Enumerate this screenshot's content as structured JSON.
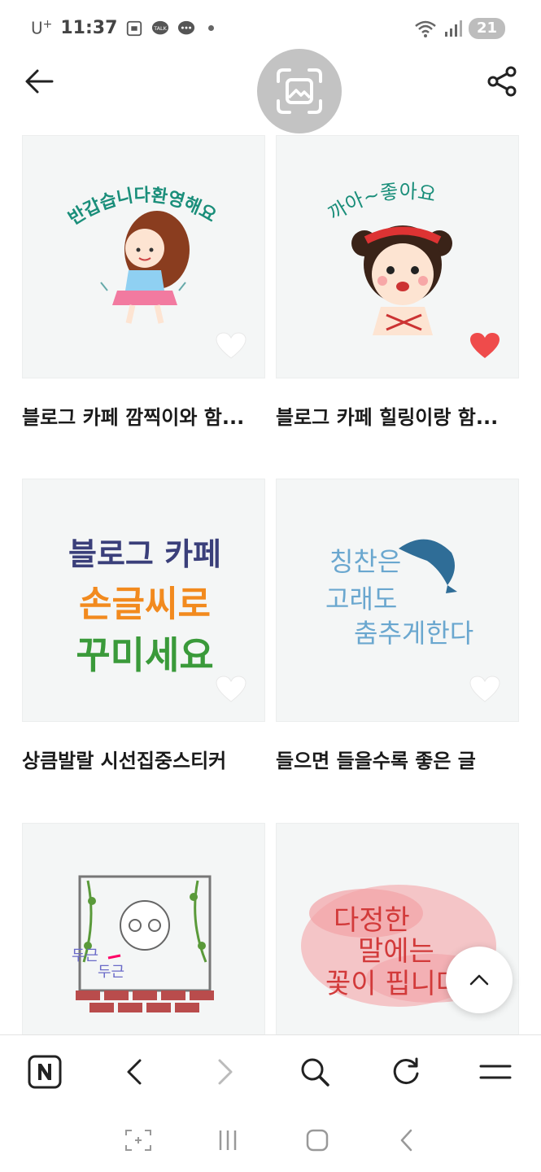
{
  "status_bar": {
    "carrier": "U",
    "carrier_sup": "+",
    "time": "11:37",
    "battery": "21"
  },
  "header": {
    "icons": [
      "back-arrow-icon",
      "image-search-icon",
      "share-icon"
    ]
  },
  "cards": [
    {
      "title": "블로그 카페 깜찍이와 함...",
      "liked": false,
      "sticker_text": "반갑습니다환영해요"
    },
    {
      "title": "블로그 카페 힐링이랑 함...",
      "liked": true,
      "sticker_text": "까아~좋아요"
    },
    {
      "title": "상큼발랄 시선집중스티커",
      "liked": false,
      "sticker_text": [
        "블로그 카페",
        "손글씨로",
        "꾸미세요"
      ]
    },
    {
      "title": "들으면 들을수록 좋은 글",
      "liked": false,
      "sticker_text": [
        "칭찬은",
        "고래도",
        "춤추게한다"
      ]
    },
    {
      "title": "",
      "liked": false,
      "sticker_text": [
        "두근",
        "두근"
      ]
    },
    {
      "title": "",
      "liked": false,
      "sticker_text": [
        "다정한",
        "말에는",
        "꽃이 핍니다"
      ]
    }
  ],
  "colors": {
    "heart_liked": "#ef4b4b",
    "heart_empty": "#ffffff",
    "thumb_bg": "#f4f6f6",
    "float_btn": "#c3c3c3"
  },
  "browser_bar": {
    "icons": [
      "naver-n-icon",
      "back-icon",
      "forward-icon",
      "search-icon",
      "refresh-icon",
      "menu-icon"
    ]
  },
  "system_nav": {
    "icons": [
      "capture-icon",
      "recents-icon",
      "home-icon",
      "system-back-icon"
    ]
  }
}
